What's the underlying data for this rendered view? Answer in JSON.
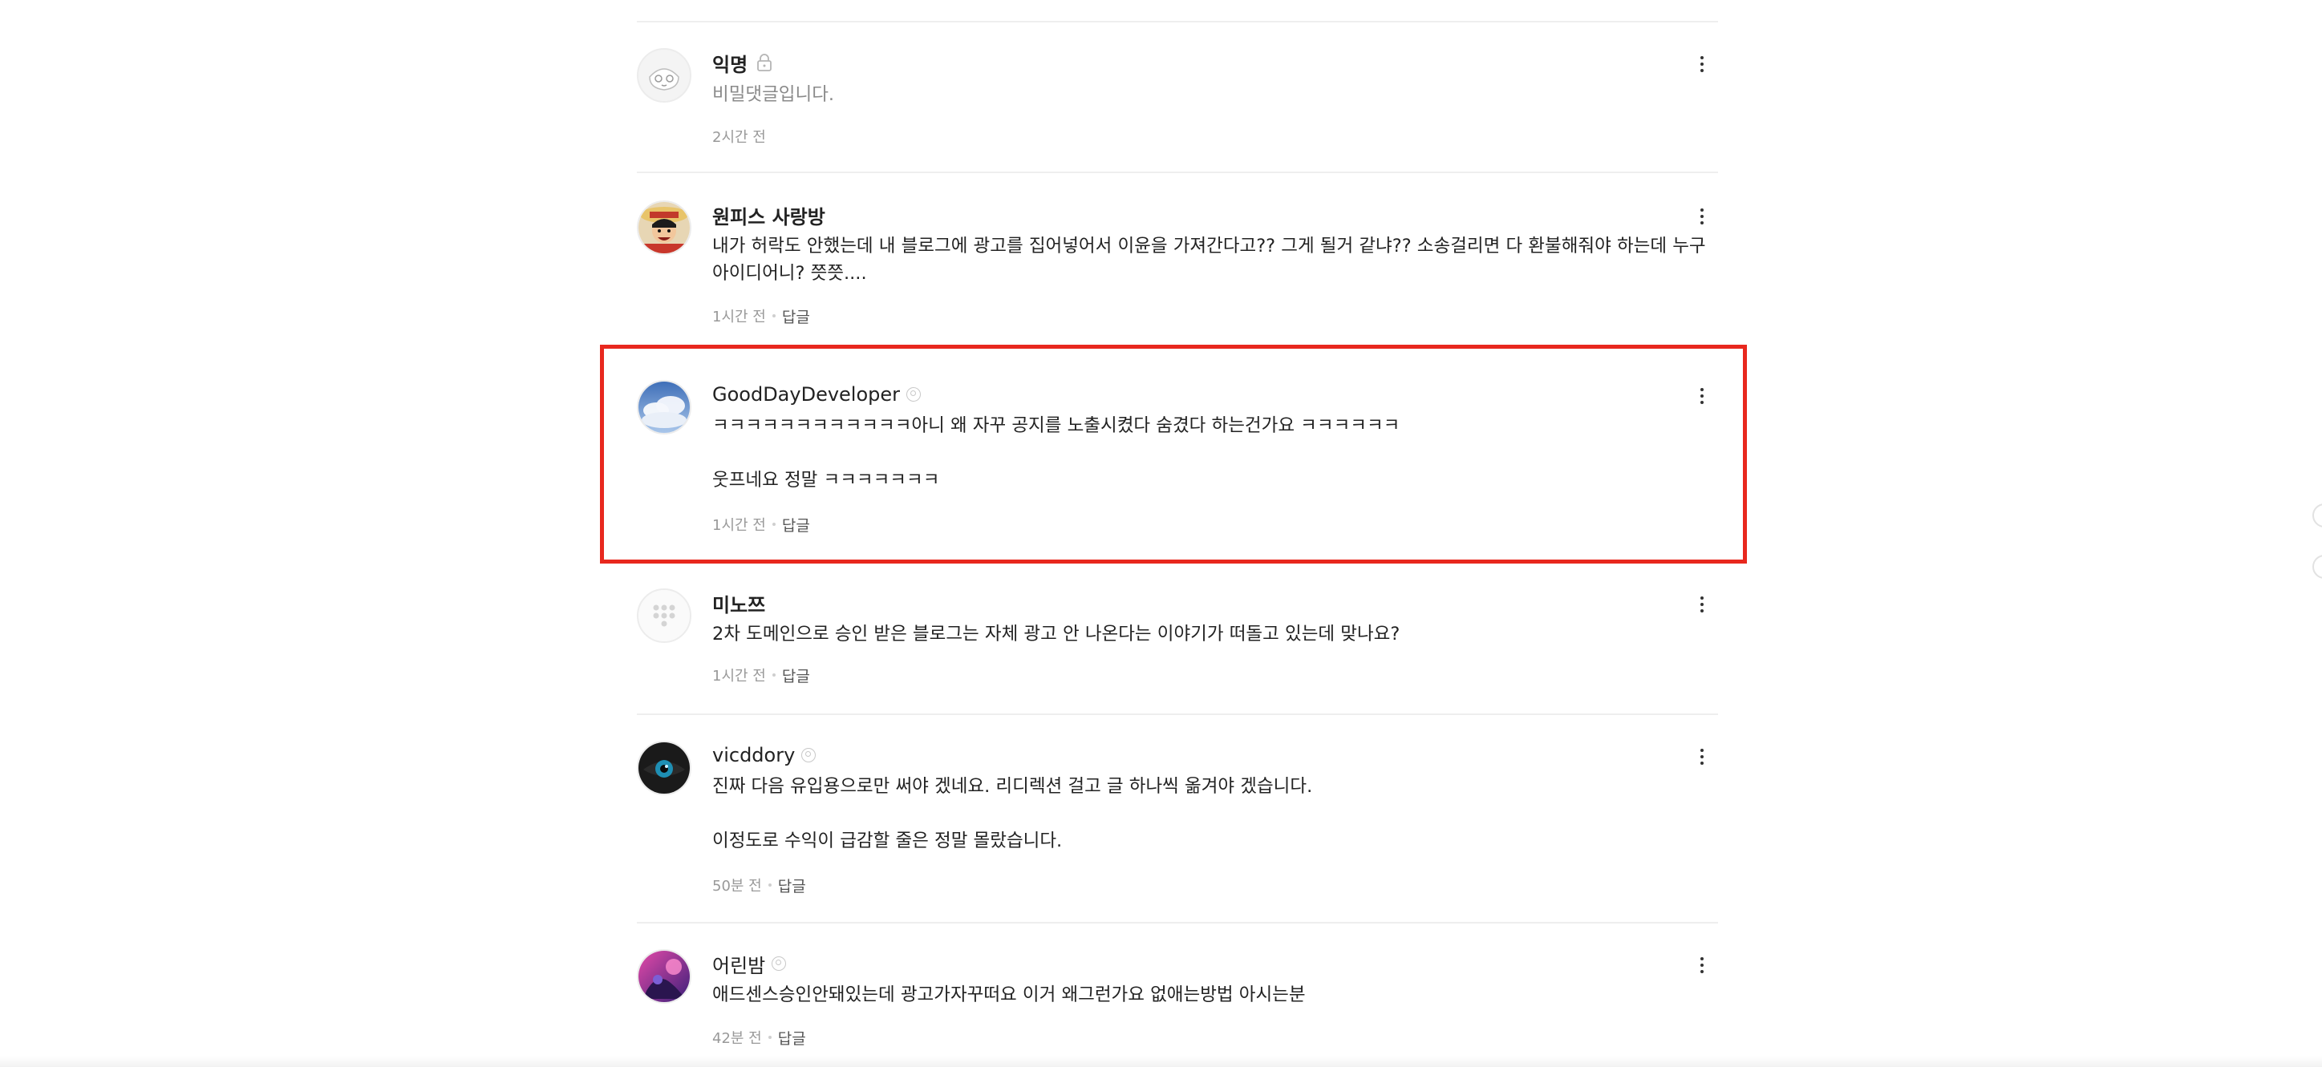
{
  "comments": [
    {
      "author": "익명",
      "text": "비밀댓글입니다.",
      "time": "2시간 전",
      "reply": "",
      "avatar": "anonymous-face"
    },
    {
      "author": "원피스 사랑방",
      "text": "내가 허락도 안했는데 내 블로그에 광고를 집어넣어서 이윤을 가져간다고?? 그게 될거 같냐?? 소송걸리면 다 환불해줘야 하는데 누구 아이디어니? 쯧쯧....",
      "time": "1시간 전",
      "reply": "답글",
      "avatar": "straw-hat-character"
    },
    {
      "author": "GoodDayDeveloper",
      "text": "ㅋㅋㅋㅋㅋㅋㅋㅋㅋㅋㅋㅋ아니 왜 자꾸 공지를 노출시켰다 숨겼다 하는건가요 ㅋㅋㅋㅋㅋㅋ\n\n웃프네요 정말 ㅋㅋㅋㅋㅋㅋㅋ",
      "time": "1시간 전",
      "reply": "답글",
      "avatar": "sky-clouds"
    },
    {
      "author": "미노쯔",
      "text": "2차 도메인으로 승인 받은 블로그는 자체 광고 안 나온다는 이야기가 떠돌고 있는데 맞나요?",
      "time": "1시간 전",
      "reply": "답글",
      "avatar": "default-dots"
    },
    {
      "author": "vicddory",
      "text": "진짜 다음 유입용으로만 써야 겠네요. 리디렉션 걸고 글 하나씩 옮겨야 겠습니다.\n\n이정도로 수익이 급감할 줄은 정말 몰랐습니다.",
      "time": "50분 전",
      "reply": "답글",
      "avatar": "blue-eye"
    },
    {
      "author": "어린밤",
      "text": "애드센스승인안돼있는데 광고가자꾸떠요 이거 왜그런가요 없애는방법 아시는분",
      "time": "42분 전",
      "reply": "답글",
      "avatar": "purple-anime"
    }
  ],
  "colors": {
    "highlight": "#e8281e",
    "divider": "#eeeeee",
    "meta": "#999999"
  }
}
